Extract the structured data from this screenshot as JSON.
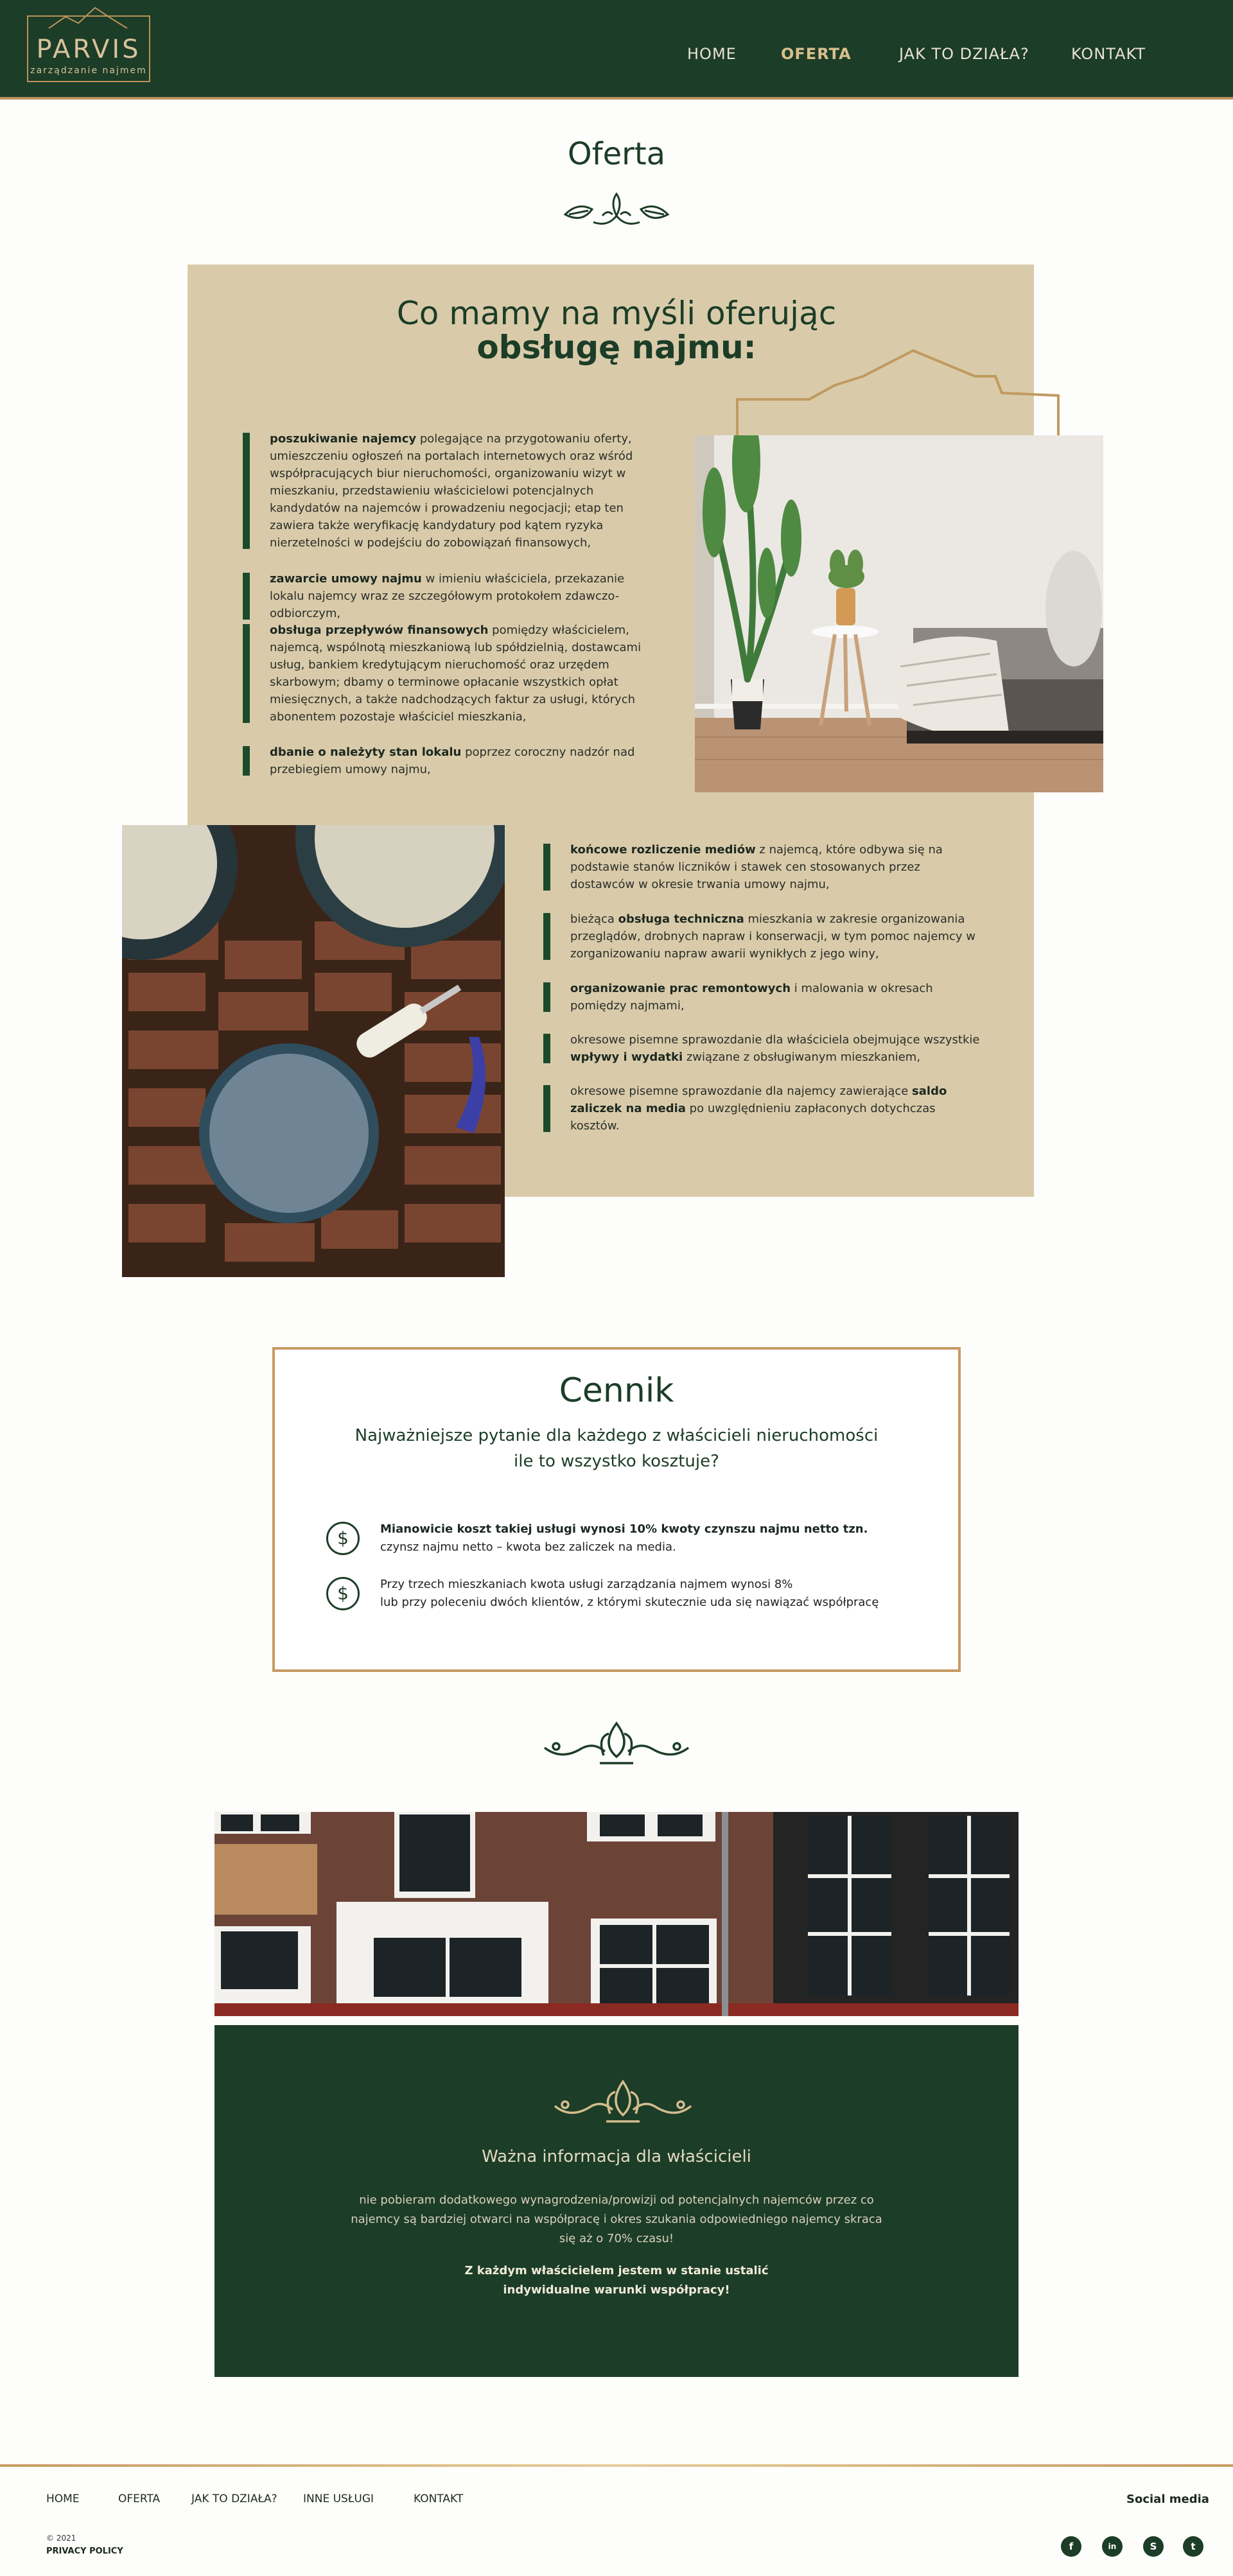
{
  "header": {
    "logo_brand": "PARVIS",
    "logo_tagline": "zarządzanie najmem",
    "nav": [
      {
        "label": "HOME"
      },
      {
        "label": "OFERTA"
      },
      {
        "label": "JAK TO DZIAŁA?"
      },
      {
        "label": "KONTAKT"
      }
    ]
  },
  "offer": {
    "title": "Oferta",
    "heading_line1": "Co mamy na myśli oferując",
    "heading_line2": "obsługę najmu:",
    "items_left": [
      {
        "strong": "poszukiwanie najemcy",
        "text": " polegające na przygotowaniu oferty, umieszczeniu ogłoszeń na portalach internetowych oraz wśród współpracujących biur nieruchomości, organizowaniu wizyt w mieszkaniu, przedstawieniu właścicielowi potencjalnych kandydatów na najemców i prowadzeniu negocjacji; etap ten zawiera także weryfikację kandydatury pod kątem ryzyka nierzetelności w podejściu do zobowiązań finansowych,"
      },
      {
        "strong": "zawarcie umowy najmu",
        "text": " w imieniu właściciela, przekazanie lokalu najemcy wraz ze szczegółowym protokołem zdawczo-odbiorczym,"
      },
      {
        "strong": "obsługa przepływów finansowych",
        "text": " pomiędzy właścicielem, najemcą, wspólnotą mieszkaniową lub spółdzielnią, dostawcami usług, bankiem kredytującym nieruchomość oraz urzędem skarbowym; dbamy o terminowe opłacanie wszystkich opłat miesięcznych, a także nadchodzących faktur za usługi, których abonentem pozostaje właściciel mieszkania,"
      },
      {
        "strong": "dbanie o należyty stan lokalu",
        "text": " poprzez coroczny nadzór nad przebiegiem umowy najmu,"
      }
    ],
    "items_right": [
      {
        "pre": "",
        "strong": "końcowe rozliczenie mediów",
        "text": " z najemcą, które odbywa się na podstawie stanów liczników i stawek cen stosowanych przez dostawców w okresie trwania umowy najmu,"
      },
      {
        "pre": "bieżąca ",
        "strong": "obsługa techniczna",
        "text": " mieszkania w zakresie organizowania przeglądów, drobnych napraw i konserwacji, w tym pomoc najemcy w zorganizowaniu napraw awarii wynikłych z jego winy,"
      },
      {
        "pre": "",
        "strong": "organizowanie prac remontowych",
        "text": " i malowania w okresach pomiędzy najmami,"
      },
      {
        "pre": "okresowe pisemne sprawozdanie dla właściciela obejmujące wszystkie ",
        "strong": "wpływy i wydatki",
        "text": " związane z obsługiwanym mieszkaniem,"
      },
      {
        "pre": "okresowe pisemne sprawozdanie dla najemcy zawierające ",
        "strong": "saldo zaliczek na media",
        "text": " po uwzględnieniu zapłaconych dotychczas kosztów."
      }
    ]
  },
  "cennik": {
    "title": "Cennik",
    "subtitle_line1": "Najważniejsze pytanie dla każdego z właścicieli nieruchomości",
    "subtitle_line2": "ile to wszystko kosztuje?",
    "rows": [
      {
        "line1": "Mianowicie koszt takiej usługi wynosi 10% kwoty czynszu najmu netto tzn.",
        "line2": "czynsz najmu netto – kwota bez zaliczek na media."
      },
      {
        "line1": "Przy trzech mieszkaniach kwota usługi zarządzania najmem wynosi 8%",
        "line2": "lub przy poleceniu dwóch klientów, z którymi skutecznie uda się nawiązać współpracę"
      }
    ],
    "icon": "$"
  },
  "info": {
    "title": "Ważna informacja dla właścicieli",
    "body": "nie pobieram dodatkowego wynagrodzenia/prowizji od potencjalnych najemców przez co najemcy są bardziej otwarci na współpracę i okres szukania odpowiedniego najemcy skraca się aż o 70% czasu!",
    "bold_line1": "Z każdym właścicielem jestem w stanie ustalić",
    "bold_line2": "indywidualne warunki współpracy!"
  },
  "footer": {
    "nav": [
      {
        "label": "HOME"
      },
      {
        "label": "OFERTA"
      },
      {
        "label": "JAK TO DZIAŁA?"
      },
      {
        "label": "INNE USŁUGI"
      },
      {
        "label": "KONTAKT"
      }
    ],
    "copyright": "© 2021",
    "privacy": "PRIVACY POLICY",
    "social_label": "Social media",
    "social": [
      {
        "name": "facebook-icon",
        "glyph": "f"
      },
      {
        "name": "linkedin-icon",
        "glyph": "in"
      },
      {
        "name": "skype-icon",
        "glyph": "S"
      },
      {
        "name": "twitter-icon",
        "glyph": "t"
      }
    ]
  },
  "colors": {
    "green": "#1c3d27",
    "beige": "#d9cbaa",
    "gold": "#c79b62"
  }
}
